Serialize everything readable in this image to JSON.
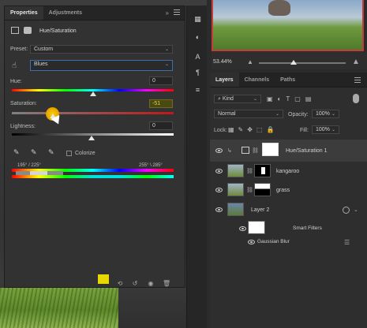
{
  "properties": {
    "tabs": [
      "Properties",
      "Adjustments"
    ],
    "title": "Hue/Saturation",
    "preset_label": "Preset:",
    "preset_value": "Custom",
    "channel_value": "Blues",
    "hue_label": "Hue:",
    "hue_value": "0",
    "saturation_label": "Saturation:",
    "saturation_value": "-51",
    "lightness_label": "Lightness:",
    "lightness_value": "0",
    "colorize_label": "Colorize",
    "range_left": "195° / 225°",
    "range_right": "255° \\ 285°"
  },
  "navigator": {
    "zoom": "53.44%"
  },
  "layers": {
    "tabs": [
      "Layers",
      "Channels",
      "Paths"
    ],
    "filter_kind": "Kind",
    "blend_mode": "Normal",
    "opacity_label": "Opacity:",
    "opacity_value": "100%",
    "lock_label": "Lock:",
    "fill_label": "Fill:",
    "fill_value": "100%",
    "rows": [
      {
        "name": "Hue/Saturation 1"
      },
      {
        "name": "kangaroo"
      },
      {
        "name": "grass"
      },
      {
        "name": "Layer 2"
      },
      {
        "name": "Smart Filters"
      },
      {
        "name": "Gaussian Blur"
      }
    ]
  },
  "colors": {
    "highlight": "#e6d800",
    "selection_border": "#c43c3c",
    "panel_bg": "#323232"
  }
}
